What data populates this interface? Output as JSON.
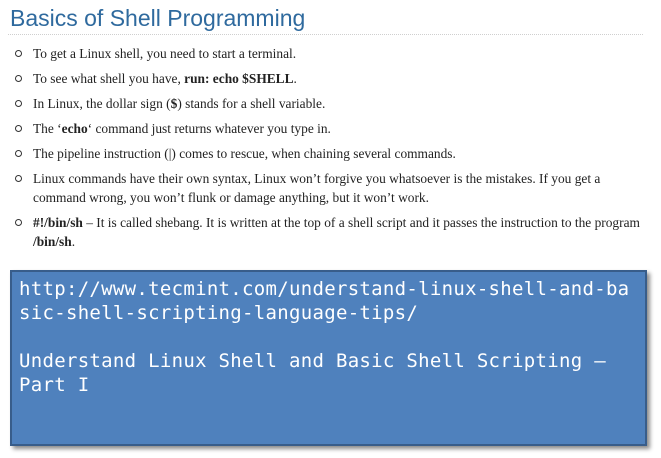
{
  "heading": "Basics of Shell Programming",
  "bullets": [
    {
      "pre": "To get a Linux shell, you need to start a terminal.",
      "bold": "",
      "post": ""
    },
    {
      "pre": "To see what shell you have, ",
      "bold": "run: echo $SHELL",
      "post": "."
    },
    {
      "pre": "In Linux, the dollar sign (",
      "bold": "$",
      "post": ") stands for a shell variable."
    },
    {
      "pre": "The ‘",
      "bold": "echo",
      "post": "‘ command just returns whatever you type in."
    },
    {
      "pre": "The pipeline instruction (|) comes to rescue, when chaining several commands.",
      "bold": "",
      "post": ""
    },
    {
      "pre": "Linux commands have their own syntax, Linux won’t forgive you whatsoever is the mistakes. If you get a command wrong, you won’t flunk or damage anything, but it won’t work.",
      "bold": "",
      "post": ""
    },
    {
      "bold": "#!/bin/sh",
      "mid": " – It is called shebang. It is written at the top of a shell script and it passes the instruction to the program ",
      "bold2": "/bin/sh",
      "post": "."
    }
  ],
  "banner": {
    "url": "http://www.tecmint.com/understand-linux-shell-and-basic-shell-scripting-language-tips/",
    "title": "Understand Linux Shell and Basic Shell Scripting – Part I"
  }
}
